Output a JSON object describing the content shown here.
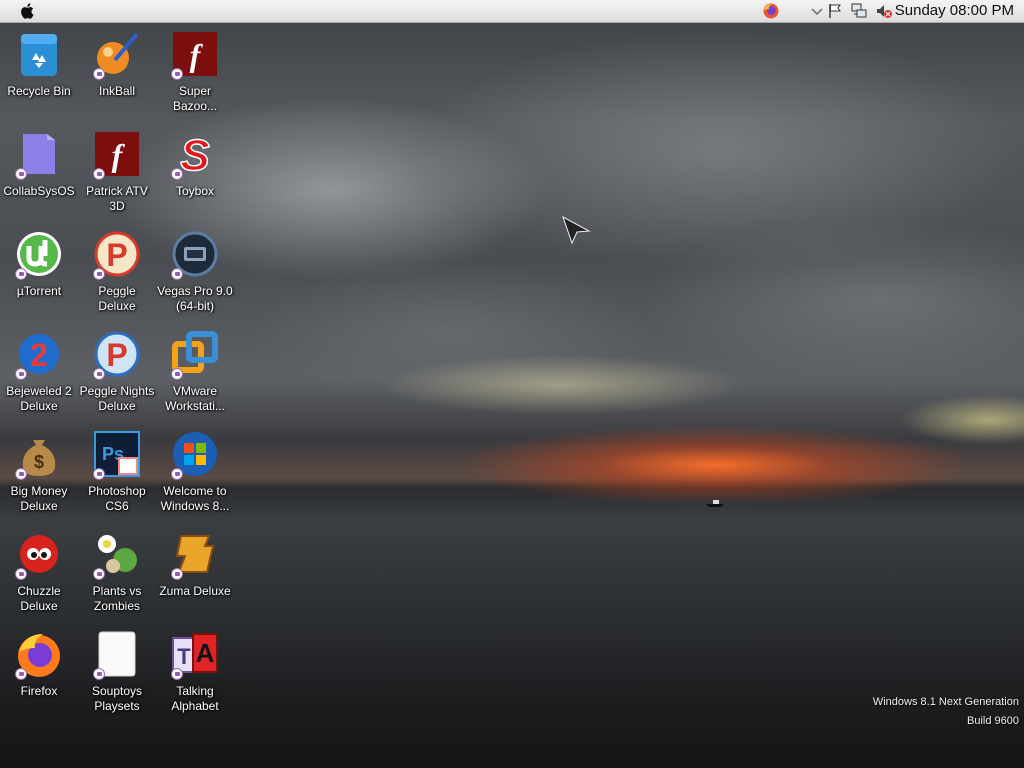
{
  "menubar": {
    "apple_icon": "apple-logo-icon",
    "tray_icons": [
      "firefox-icon",
      "chevron-down-icon",
      "flag-icon",
      "network-icon",
      "volume-muted-icon"
    ],
    "clock": "Sunday 08:00 PM"
  },
  "desktop": {
    "icons": [
      {
        "label": "Recycle Bin",
        "icon": "recycle-bin-icon"
      },
      {
        "label": "InkBall",
        "icon": "inkball-icon"
      },
      {
        "label": "Super Bazoo...",
        "icon": "flash-icon"
      },
      {
        "label": "CollabSysOS",
        "icon": "folder-icon"
      },
      {
        "label": "Patrick ATV 3D",
        "icon": "flash-icon"
      },
      {
        "label": "Toybox",
        "icon": "toybox-icon"
      },
      {
        "label": "µTorrent",
        "icon": "utorrent-icon"
      },
      {
        "label": "Peggle Deluxe",
        "icon": "peggle-icon"
      },
      {
        "label": "Vegas Pro 9.0 (64-bit)",
        "icon": "vegas-icon"
      },
      {
        "label": "Bejeweled 2 Deluxe",
        "icon": "bejeweled-icon"
      },
      {
        "label": "Peggle Nights Deluxe",
        "icon": "peggle-nights-icon"
      },
      {
        "label": "VMware Workstati...",
        "icon": "vmware-icon"
      },
      {
        "label": "Big Money Deluxe",
        "icon": "money-bag-icon"
      },
      {
        "label": "Photoshop CS6",
        "icon": "photoshop-icon"
      },
      {
        "label": "Welcome to Windows 8...",
        "icon": "windows-icon"
      },
      {
        "label": "Chuzzle Deluxe",
        "icon": "chuzzle-icon"
      },
      {
        "label": "Plants vs Zombies",
        "icon": "plants-icon"
      },
      {
        "label": "Zuma Deluxe",
        "icon": "zuma-icon"
      },
      {
        "label": "Firefox",
        "icon": "firefox-icon"
      },
      {
        "label": "Souptoys Playsets",
        "icon": "blank-file-icon"
      },
      {
        "label": "Talking Alphabet",
        "icon": "alphabet-icon"
      }
    ]
  },
  "watermark": {
    "line1": "Windows 8.1 Next Generation",
    "line2": "Build 9600"
  }
}
